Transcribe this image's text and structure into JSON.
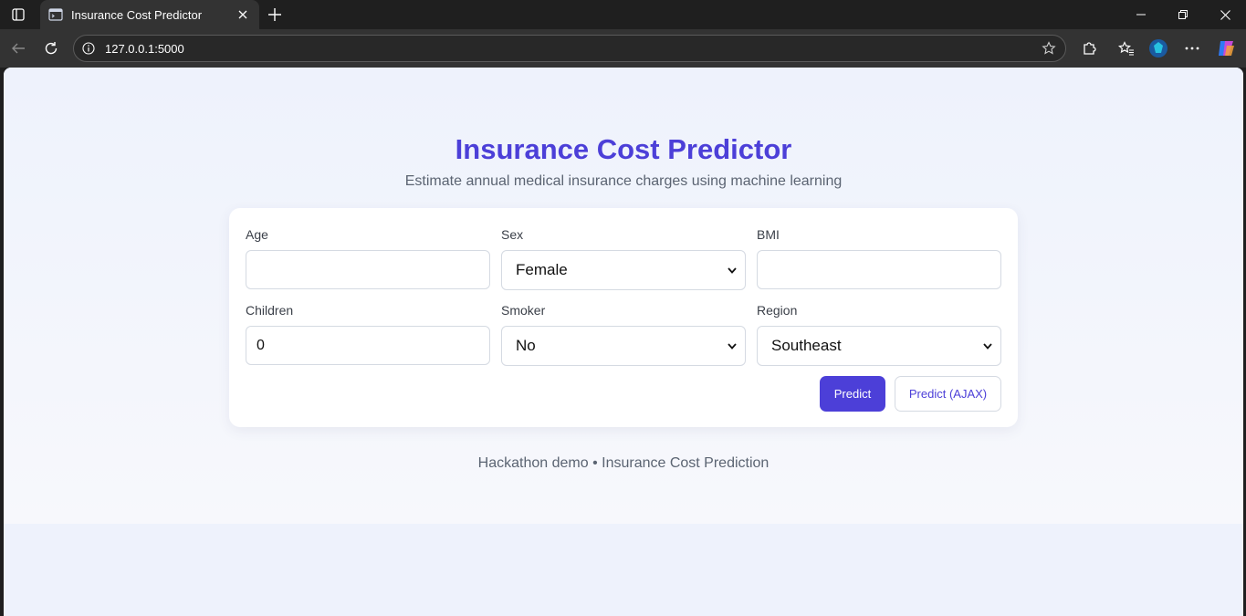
{
  "browser": {
    "tab_title": "Insurance Cost Predictor",
    "url": "127.0.0.1:5000"
  },
  "page": {
    "title": "Insurance Cost Predictor",
    "subtitle": "Estimate annual medical insurance charges using machine learning",
    "footer": "Hackathon demo • Insurance Cost Prediction"
  },
  "form": {
    "age": {
      "label": "Age",
      "value": ""
    },
    "sex": {
      "label": "Sex",
      "value": "Female"
    },
    "bmi": {
      "label": "BMI",
      "value": ""
    },
    "children": {
      "label": "Children",
      "value": "0"
    },
    "smoker": {
      "label": "Smoker",
      "value": "No"
    },
    "region": {
      "label": "Region",
      "value": "Southeast"
    },
    "predict_label": "Predict",
    "predict_ajax_label": "Predict (AJAX)"
  },
  "colors": {
    "accent": "#4c3fd8",
    "page_bg": "#eef2fc",
    "browser_chrome": "#333333"
  }
}
